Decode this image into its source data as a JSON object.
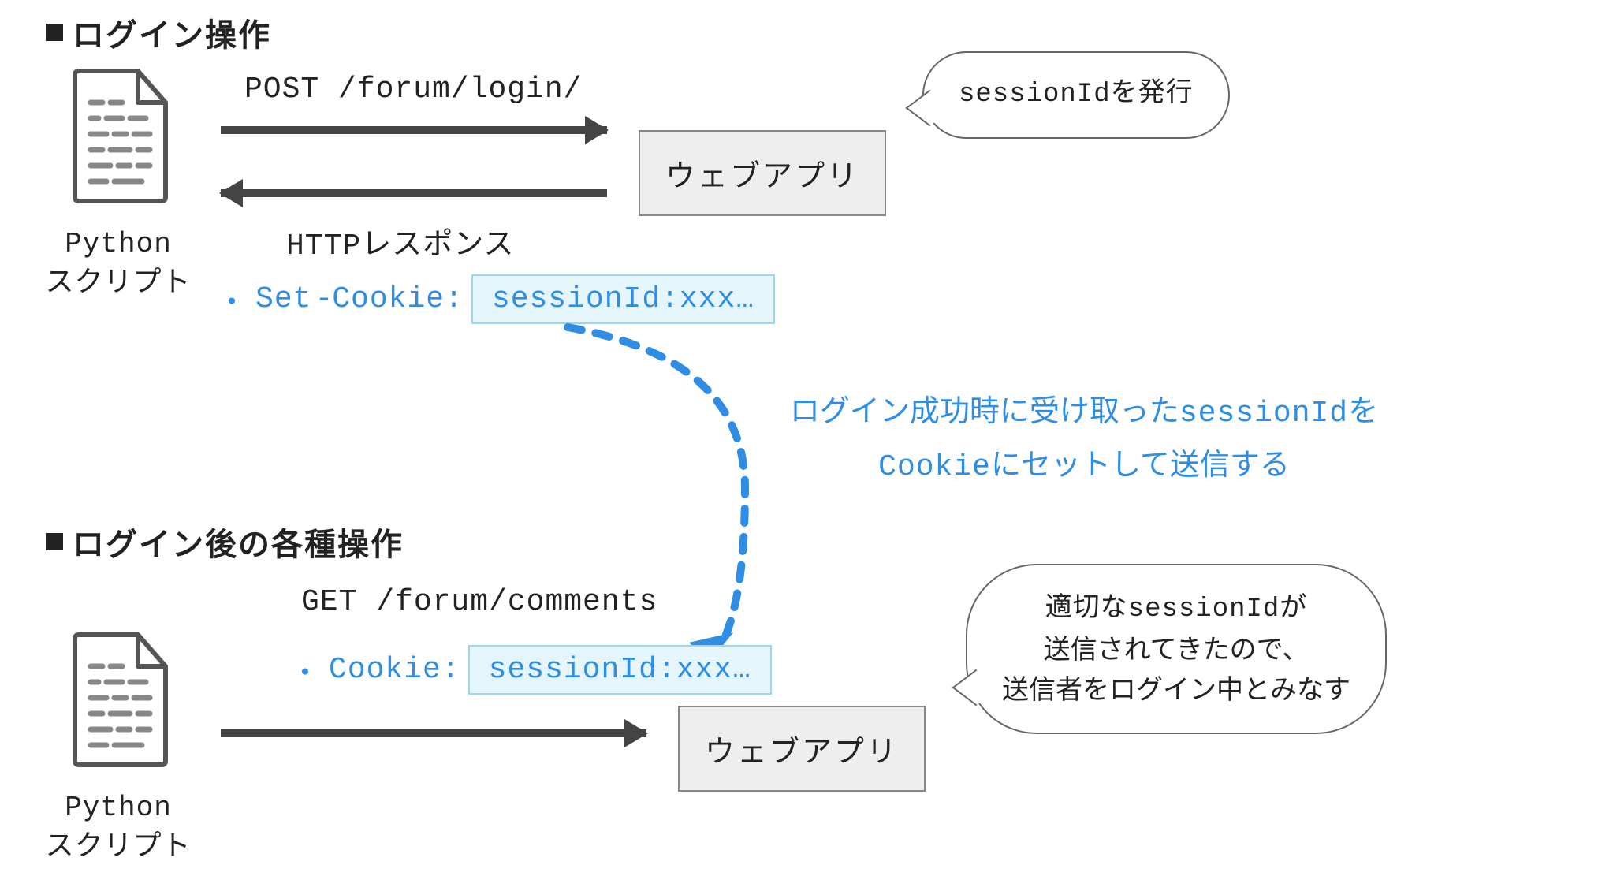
{
  "sections": {
    "login": {
      "title": "ログイン操作"
    },
    "after": {
      "title": "ログイン後の各種操作"
    }
  },
  "script": {
    "label_line1": "Python",
    "label_line2": "スクリプト"
  },
  "webapp": {
    "label": "ウェブアプリ"
  },
  "requests": {
    "login": "POST /forum/login/",
    "response": "HTTPレスポンス",
    "comments": "GET /forum/comments"
  },
  "headers": {
    "set_cookie_key": "Set-Cookie:",
    "cookie_key": "Cookie:",
    "session_value": "sessionId:xxx…",
    "bullet": "・"
  },
  "speech": {
    "issue": "sessionIdを発行",
    "valid_l1": "適切なsessionIdが",
    "valid_l2": "送信されてきたので、",
    "valid_l3": "送信者をログイン中とみなす"
  },
  "note": {
    "l1a": "ログイン成功時に受け取った",
    "l1b": "sessionId",
    "l1c": "を",
    "l2a": "Cookie",
    "l2b": "にセットして送信する"
  },
  "icons": {
    "doc": "doc-icon",
    "bullet": "square-bullet-icon"
  }
}
